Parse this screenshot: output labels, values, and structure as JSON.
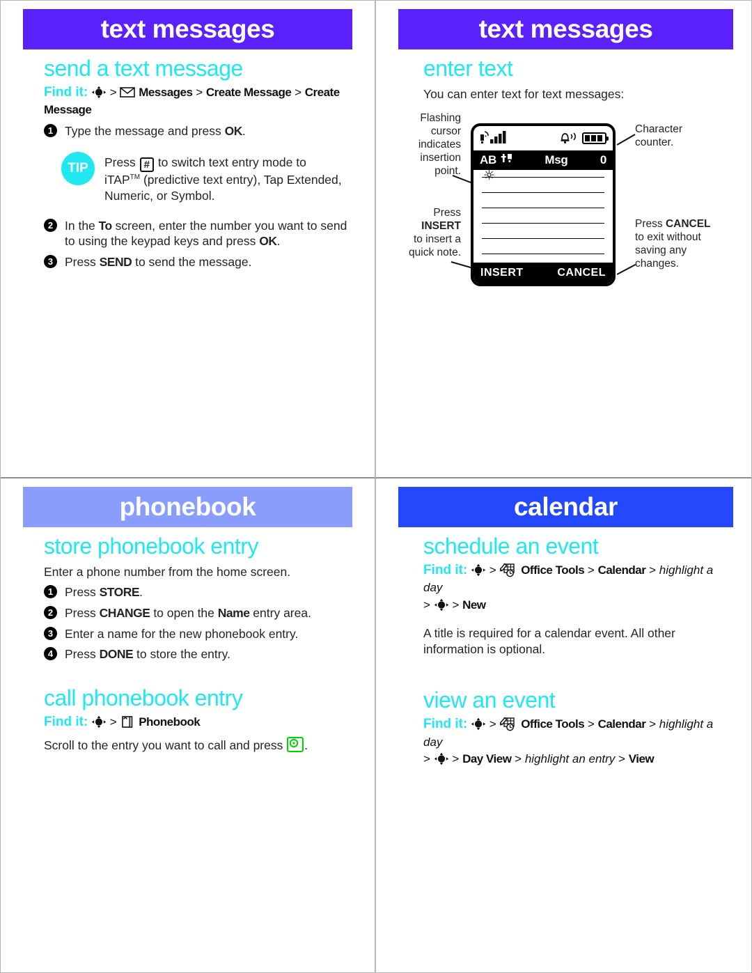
{
  "colors": {
    "purple": "#5a21fb",
    "periwinkle": "#8b9dfc",
    "blue": "#2448fb",
    "cyan": "#1ee9f0",
    "green": "#00d200"
  },
  "panels": {
    "text_messages_send": {
      "banner": "text messages",
      "section_title": "send a text message",
      "find_it": {
        "label": "Find it:",
        "path": [
          "nav-icon",
          ">",
          "envelope-icon",
          "Messages",
          ">",
          "Create Message",
          ">",
          "Create Message"
        ]
      },
      "steps": [
        {
          "num": "1",
          "text_before": "Type the message and press ",
          "bold": "OK",
          "text_after": "."
        },
        {
          "num": "2",
          "text": "In the To screen, enter the number you want to send to using the keypad keys and press OK."
        },
        {
          "num": "3",
          "text": "Press SEND to send the message."
        }
      ],
      "tip": {
        "badge": "TIP",
        "line1_before": "Press ",
        "key": "#",
        "line1_after": " to switch text entry mode to",
        "line2": "iTAP",
        "line2_tm": "TM",
        "line2_rest": " (predictive text entry), Tap Extended,",
        "line3": "Numeric, or Symbol."
      }
    },
    "text_messages_enter": {
      "banner": "text messages",
      "section_title": "enter text",
      "intro": "You can enter text for text messages:",
      "phone": {
        "title_mode": "AB",
        "title_center": "Msg",
        "counter": "0",
        "softkey_left": "INSERT",
        "softkey_right": "CANCEL",
        "line_count": 6,
        "signal_icon": "signal-bars-icon",
        "ringer_icon": "ringer-bell-icon",
        "battery_icon": "battery-icon"
      },
      "annotations": {
        "flashing_cursor": "Flashing cursor indicates insertion point.",
        "insert": {
          "pre": "Press",
          "bold": "INSERT",
          "post": "to insert a quick note."
        },
        "character_counter": "Character counter.",
        "cancel": {
          "pre": "Press ",
          "bold": "CANCEL",
          "post": " to exit without saving any changes."
        }
      }
    },
    "phonebook": {
      "banner": "phonebook",
      "store": {
        "section_title": "store phonebook entry",
        "intro": "Enter a phone number from the home screen.",
        "steps": [
          {
            "num": "1",
            "text": "Press STORE."
          },
          {
            "num": "2",
            "text": "Press CHANGE to open the Name entry area."
          },
          {
            "num": "3",
            "text": "Enter a name for the new phonebook entry."
          },
          {
            "num": "4",
            "text": "Press DONE to store the entry."
          }
        ]
      },
      "call": {
        "section_title": "call phonebook entry",
        "find_it": {
          "label": "Find it:",
          "path": [
            "nav-icon",
            ">",
            "phonebook-icon",
            "Phonebook"
          ]
        },
        "body_before": "Scroll to the entry you want to call and press ",
        "body_after": "."
      }
    },
    "calendar": {
      "banner": "calendar",
      "schedule": {
        "section_title": "schedule an event",
        "find_it": {
          "label": "Find it:",
          "path": [
            "nav-icon",
            ">",
            "office-tools-icon",
            "Office Tools",
            ">",
            "Calendar",
            ">",
            "highlight a day",
            ">",
            "nav-icon",
            ">",
            "New"
          ]
        },
        "body": "A title is required for a calendar event. All other information is optional."
      },
      "view": {
        "section_title": "view an event",
        "find_it": {
          "label": "Find it:",
          "path": [
            "nav-icon",
            ">",
            "office-tools-icon",
            "Office Tools",
            ">",
            "Calendar",
            ">",
            "highlight a day",
            ">",
            "nav-icon",
            ">",
            "Day View",
            ">",
            "highlight an entry",
            ">",
            "View"
          ]
        }
      }
    }
  },
  "labels": {
    "step1_pre": "Type the message and press ",
    "step1_ok": "OK",
    "step1_post": ".",
    "step2_a": "In the ",
    "step2_to": "To",
    "step2_b": " screen, enter the number you want to send",
    "step2_c": "to using the keypad keys and press ",
    "step2_ok": "OK",
    "step2_d": ".",
    "step3_a": "Press ",
    "step3_send": "SEND",
    "step3_b": " to send the message.",
    "pb1_a": "Press ",
    "pb1_b": "STORE",
    "pb1_c": ".",
    "pb2_a": "Press ",
    "pb2_b": "CHANGE",
    "pb2_c": " to open the ",
    "pb2_d": "Name",
    "pb2_e": " entry area.",
    "pb3": "Enter a name for the new phonebook entry.",
    "pb4_a": "Press ",
    "pb4_b": "DONE",
    "pb4_c": " to store the entry.",
    "gt": ">",
    "messages": "Messages",
    "create_message": "Create Message",
    "phonebook_item": "Phonebook",
    "office_tools": "Office Tools",
    "calendar_item": "Calendar",
    "highlight_day": "highlight a day",
    "new_item": "New",
    "day_view": "Day View",
    "highlight_entry": "highlight an entry",
    "view_item": "View"
  }
}
